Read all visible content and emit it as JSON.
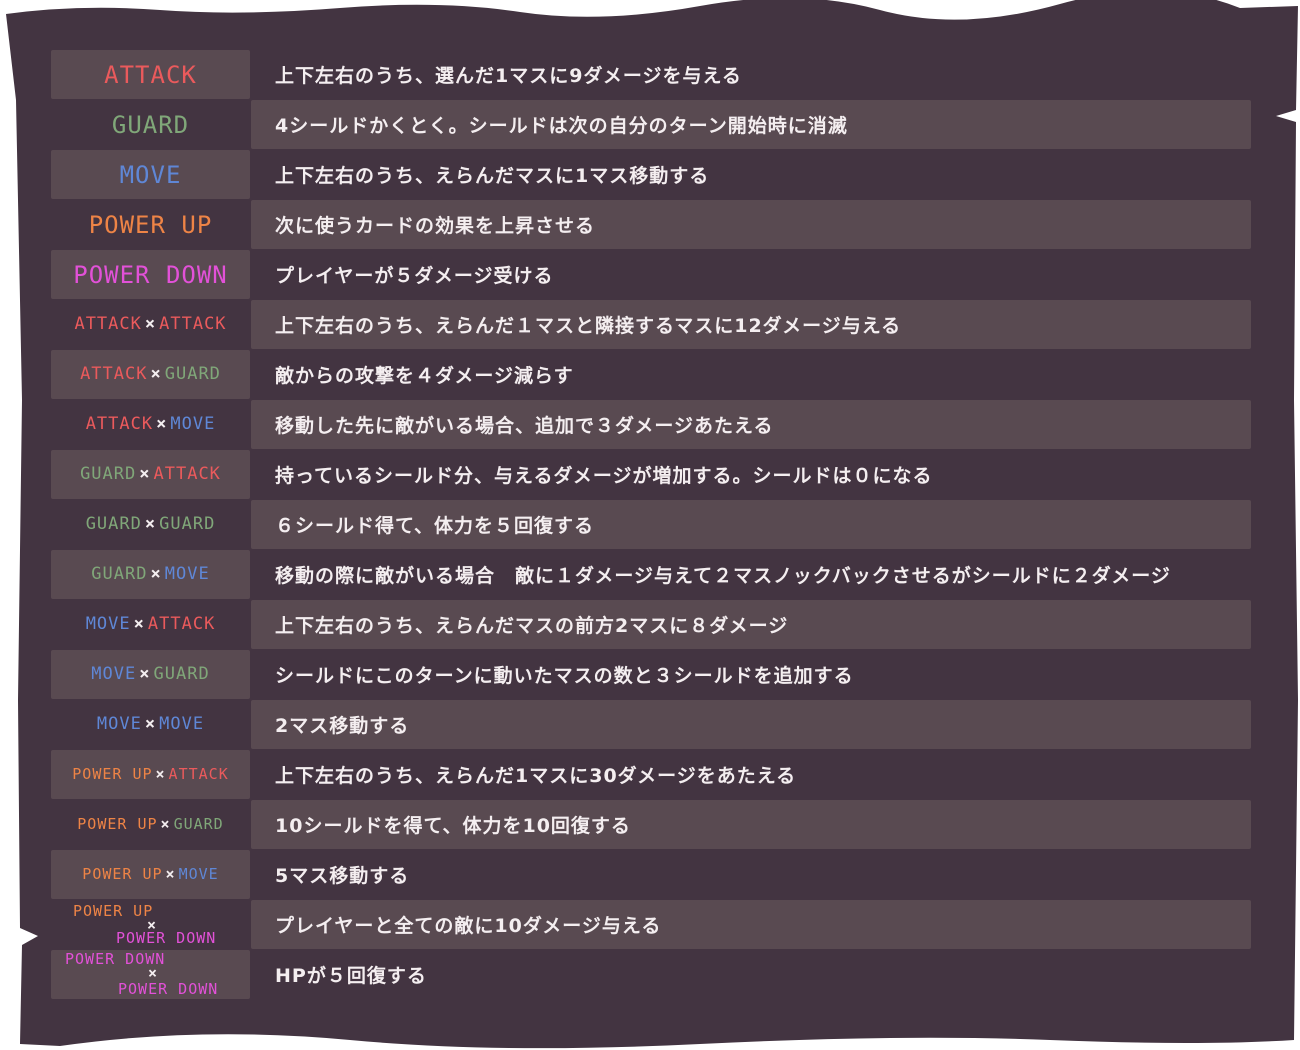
{
  "colors": {
    "board": "#433441",
    "row_shade": "#594a51",
    "attack": "#ea5a5c",
    "guard": "#80a779",
    "move": "#5f87d6",
    "power_up": "#ee8446",
    "power_down": "#e251d8",
    "text": "#f4eef0"
  },
  "cards": {
    "attack": "ATTACK",
    "guard": "GUARD",
    "move": "MOVE",
    "power_up": "POWER UP",
    "power_down": "POWER DOWN",
    "times": "×"
  },
  "rows": [
    {
      "desc": "上下左右のうち、選んだ1マスに9ダメージを与える"
    },
    {
      "desc": "4シールドかくとく。シールドは次の自分のターン開始時に消滅"
    },
    {
      "desc": "上下左右のうち、えらんだマスに1マス移動する"
    },
    {
      "desc": "次に使うカードの効果を上昇させる"
    },
    {
      "desc": "プレイヤーが５ダメージ受ける"
    },
    {
      "desc": "上下左右のうち、えらんだ１マスと隣接するマスに12ダメージ与える"
    },
    {
      "desc": "敵からの攻撃を４ダメージ減らす"
    },
    {
      "desc": "移動した先に敵がいる場合、追加で３ダメージあたえる"
    },
    {
      "desc": "持っているシールド分、与えるダメージが増加する。シールドは０になる"
    },
    {
      "desc": "６シールド得て、体力を５回復する"
    },
    {
      "desc": "移動の際に敵がいる場合　敵に１ダメージ与えて２マスノックバックさせるがシールドに２ダメージ"
    },
    {
      "desc": "上下左右のうち、えらんだマスの前方2マスに８ダメージ"
    },
    {
      "desc": "シールドにこのターンに動いたマスの数と３シールドを追加する"
    },
    {
      "desc": "2マス移動する"
    },
    {
      "desc": "上下左右のうち、えらんだ1マスに30ダメージをあたえる"
    },
    {
      "desc": "10シールドを得て、体力を10回復する"
    },
    {
      "desc": "5マス移動する"
    },
    {
      "desc": "プレイヤーと全ての敵に10ダメージ与える"
    },
    {
      "desc": "HPが５回復する"
    }
  ]
}
